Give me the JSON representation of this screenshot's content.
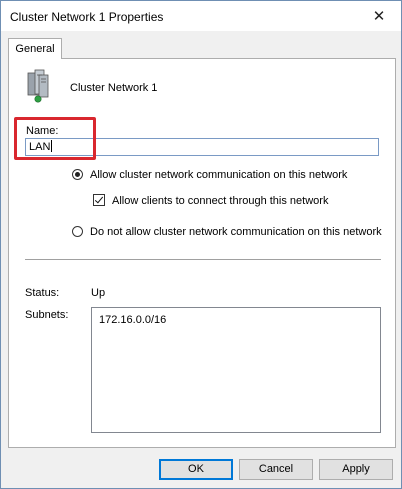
{
  "window": {
    "title": "Cluster Network 1 Properties",
    "close_glyph": "✕"
  },
  "tabs": [
    {
      "label": "General",
      "selected": true
    }
  ],
  "general": {
    "cluster_name": "Cluster Network 1",
    "icon": "server-cluster-icon",
    "name_label": "Name:",
    "name_value": "LAN",
    "options": {
      "allow_communication": {
        "label": "Allow cluster network communication on this network",
        "selected": true
      },
      "allow_clients": {
        "label": "Allow clients to connect through this network",
        "checked": true
      },
      "deny_communication": {
        "label": "Do not allow cluster network communication on this network",
        "selected": false
      }
    },
    "status_label": "Status:",
    "status_value": "Up",
    "subnets_label": "Subnets:",
    "subnets": [
      "172.16.0.0/16"
    ]
  },
  "buttons": {
    "ok": "OK",
    "cancel": "Cancel",
    "apply": "Apply"
  },
  "colors": {
    "highlight": "#d9272e",
    "input_border": "#7a9ac5",
    "default_button_border": "#0078d7"
  }
}
